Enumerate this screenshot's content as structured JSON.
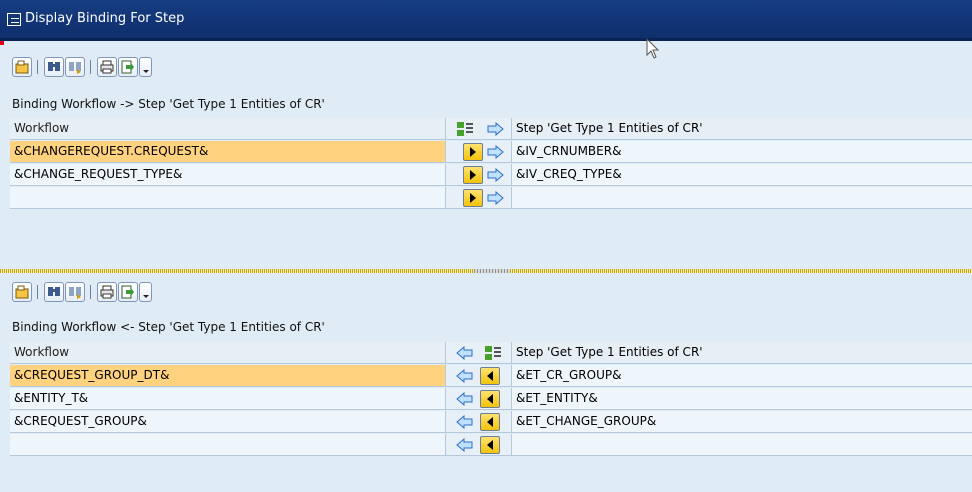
{
  "window": {
    "title": "Display Binding For Step"
  },
  "toolbar_icons": [
    "select-layout-icon",
    "find-icon",
    "find-next-icon",
    "print-icon",
    "export-icon"
  ],
  "top_section": {
    "label": "Binding Workflow  -> Step 'Get Type 1 Entities of CR'",
    "header": {
      "workflow": "Workflow",
      "step": "Step 'Get Type 1 Entities of CR'"
    },
    "rows": [
      {
        "workflow": "&CHANGEREQUEST.CREQUEST&",
        "step": "&IV_CRNUMBER&",
        "selected": true
      },
      {
        "workflow": "&CHANGE_REQUEST_TYPE&",
        "step": "&IV_CREQ_TYPE&",
        "selected": false
      },
      {
        "workflow": "",
        "step": "",
        "selected": false
      }
    ]
  },
  "bottom_section": {
    "label": "Binding Workflow  <- Step 'Get Type 1 Entities of CR'",
    "header": {
      "workflow": "Workflow",
      "step": "Step 'Get Type 1 Entities of CR'"
    },
    "rows": [
      {
        "workflow": "&CREQUEST_GROUP_DT&",
        "step": "&ET_CR_GROUP&",
        "selected": true
      },
      {
        "workflow": "&ENTITY_T&",
        "step": "&ET_ENTITY&",
        "selected": false
      },
      {
        "workflow": "&CREQUEST_GROUP&",
        "step": "&ET_CHANGE_GROUP&",
        "selected": false
      },
      {
        "workflow": "",
        "step": "",
        "selected": false
      }
    ]
  },
  "colors": {
    "titlebar": "#163c82",
    "selected_row": "#ffd27f",
    "background": "#dfebf5"
  }
}
